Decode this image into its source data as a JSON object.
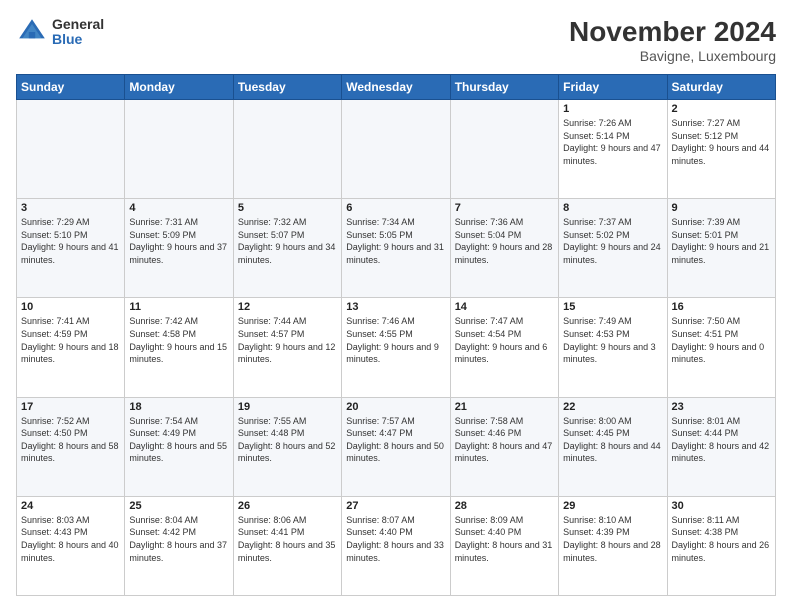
{
  "logo": {
    "general": "General",
    "blue": "Blue"
  },
  "title": "November 2024",
  "subtitle": "Bavigne, Luxembourg",
  "weekdays": [
    "Sunday",
    "Monday",
    "Tuesday",
    "Wednesday",
    "Thursday",
    "Friday",
    "Saturday"
  ],
  "weeks": [
    [
      {
        "day": "",
        "info": ""
      },
      {
        "day": "",
        "info": ""
      },
      {
        "day": "",
        "info": ""
      },
      {
        "day": "",
        "info": ""
      },
      {
        "day": "",
        "info": ""
      },
      {
        "day": "1",
        "info": "Sunrise: 7:26 AM\nSunset: 5:14 PM\nDaylight: 9 hours and 47 minutes."
      },
      {
        "day": "2",
        "info": "Sunrise: 7:27 AM\nSunset: 5:12 PM\nDaylight: 9 hours and 44 minutes."
      }
    ],
    [
      {
        "day": "3",
        "info": "Sunrise: 7:29 AM\nSunset: 5:10 PM\nDaylight: 9 hours and 41 minutes."
      },
      {
        "day": "4",
        "info": "Sunrise: 7:31 AM\nSunset: 5:09 PM\nDaylight: 9 hours and 37 minutes."
      },
      {
        "day": "5",
        "info": "Sunrise: 7:32 AM\nSunset: 5:07 PM\nDaylight: 9 hours and 34 minutes."
      },
      {
        "day": "6",
        "info": "Sunrise: 7:34 AM\nSunset: 5:05 PM\nDaylight: 9 hours and 31 minutes."
      },
      {
        "day": "7",
        "info": "Sunrise: 7:36 AM\nSunset: 5:04 PM\nDaylight: 9 hours and 28 minutes."
      },
      {
        "day": "8",
        "info": "Sunrise: 7:37 AM\nSunset: 5:02 PM\nDaylight: 9 hours and 24 minutes."
      },
      {
        "day": "9",
        "info": "Sunrise: 7:39 AM\nSunset: 5:01 PM\nDaylight: 9 hours and 21 minutes."
      }
    ],
    [
      {
        "day": "10",
        "info": "Sunrise: 7:41 AM\nSunset: 4:59 PM\nDaylight: 9 hours and 18 minutes."
      },
      {
        "day": "11",
        "info": "Sunrise: 7:42 AM\nSunset: 4:58 PM\nDaylight: 9 hours and 15 minutes."
      },
      {
        "day": "12",
        "info": "Sunrise: 7:44 AM\nSunset: 4:57 PM\nDaylight: 9 hours and 12 minutes."
      },
      {
        "day": "13",
        "info": "Sunrise: 7:46 AM\nSunset: 4:55 PM\nDaylight: 9 hours and 9 minutes."
      },
      {
        "day": "14",
        "info": "Sunrise: 7:47 AM\nSunset: 4:54 PM\nDaylight: 9 hours and 6 minutes."
      },
      {
        "day": "15",
        "info": "Sunrise: 7:49 AM\nSunset: 4:53 PM\nDaylight: 9 hours and 3 minutes."
      },
      {
        "day": "16",
        "info": "Sunrise: 7:50 AM\nSunset: 4:51 PM\nDaylight: 9 hours and 0 minutes."
      }
    ],
    [
      {
        "day": "17",
        "info": "Sunrise: 7:52 AM\nSunset: 4:50 PM\nDaylight: 8 hours and 58 minutes."
      },
      {
        "day": "18",
        "info": "Sunrise: 7:54 AM\nSunset: 4:49 PM\nDaylight: 8 hours and 55 minutes."
      },
      {
        "day": "19",
        "info": "Sunrise: 7:55 AM\nSunset: 4:48 PM\nDaylight: 8 hours and 52 minutes."
      },
      {
        "day": "20",
        "info": "Sunrise: 7:57 AM\nSunset: 4:47 PM\nDaylight: 8 hours and 50 minutes."
      },
      {
        "day": "21",
        "info": "Sunrise: 7:58 AM\nSunset: 4:46 PM\nDaylight: 8 hours and 47 minutes."
      },
      {
        "day": "22",
        "info": "Sunrise: 8:00 AM\nSunset: 4:45 PM\nDaylight: 8 hours and 44 minutes."
      },
      {
        "day": "23",
        "info": "Sunrise: 8:01 AM\nSunset: 4:44 PM\nDaylight: 8 hours and 42 minutes."
      }
    ],
    [
      {
        "day": "24",
        "info": "Sunrise: 8:03 AM\nSunset: 4:43 PM\nDaylight: 8 hours and 40 minutes."
      },
      {
        "day": "25",
        "info": "Sunrise: 8:04 AM\nSunset: 4:42 PM\nDaylight: 8 hours and 37 minutes."
      },
      {
        "day": "26",
        "info": "Sunrise: 8:06 AM\nSunset: 4:41 PM\nDaylight: 8 hours and 35 minutes."
      },
      {
        "day": "27",
        "info": "Sunrise: 8:07 AM\nSunset: 4:40 PM\nDaylight: 8 hours and 33 minutes."
      },
      {
        "day": "28",
        "info": "Sunrise: 8:09 AM\nSunset: 4:40 PM\nDaylight: 8 hours and 31 minutes."
      },
      {
        "day": "29",
        "info": "Sunrise: 8:10 AM\nSunset: 4:39 PM\nDaylight: 8 hours and 28 minutes."
      },
      {
        "day": "30",
        "info": "Sunrise: 8:11 AM\nSunset: 4:38 PM\nDaylight: 8 hours and 26 minutes."
      }
    ]
  ]
}
